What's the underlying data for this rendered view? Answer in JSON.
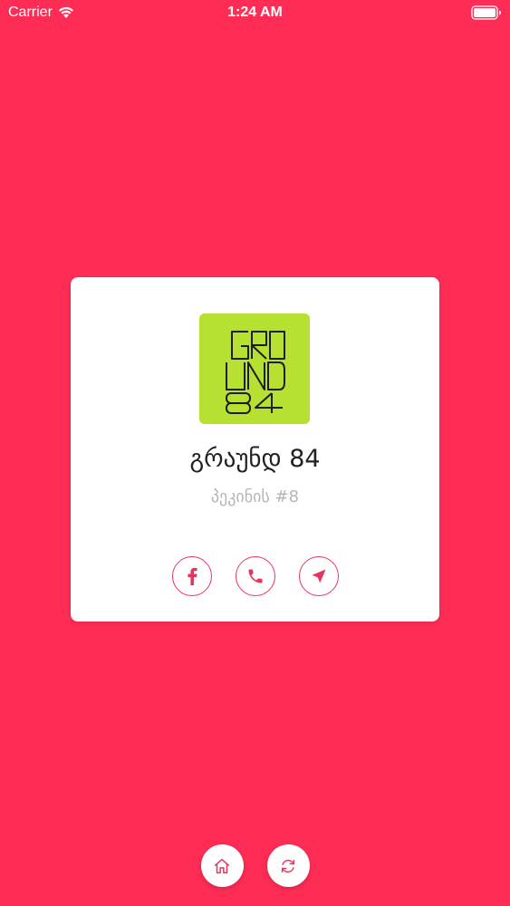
{
  "status_bar": {
    "carrier": "Carrier",
    "time": "1:24 AM"
  },
  "venue": {
    "name": "გრაუნდ 84",
    "address": "პეკინის #8",
    "logo": {
      "lines": [
        "GRO",
        "UND",
        "84"
      ],
      "background": "#b6e032"
    }
  },
  "actions": [
    {
      "icon": "facebook-icon"
    },
    {
      "icon": "phone-icon"
    },
    {
      "icon": "navigation-icon"
    }
  ],
  "bottom_nav": [
    {
      "icon": "home-icon"
    },
    {
      "icon": "refresh-icon"
    }
  ],
  "colors": {
    "background": "#ff2d55",
    "accent": "#e8345d",
    "card": "#ffffff"
  }
}
